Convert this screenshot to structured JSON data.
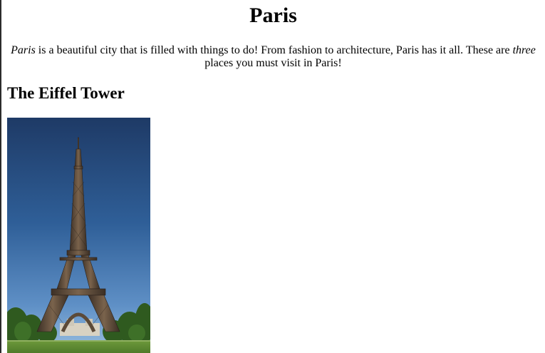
{
  "page": {
    "title": "Paris"
  },
  "intro": {
    "part1_italic": "Paris",
    "part2": " is a beautiful city that is filled with things to do! From fashion to architecture, Paris has it all. These are ",
    "part3_italic": "three",
    "part4": " places you must visit in Paris!"
  },
  "sections": [
    {
      "heading": "The Eiffel Tower",
      "image_alt": "The Eiffel Tower"
    }
  ]
}
